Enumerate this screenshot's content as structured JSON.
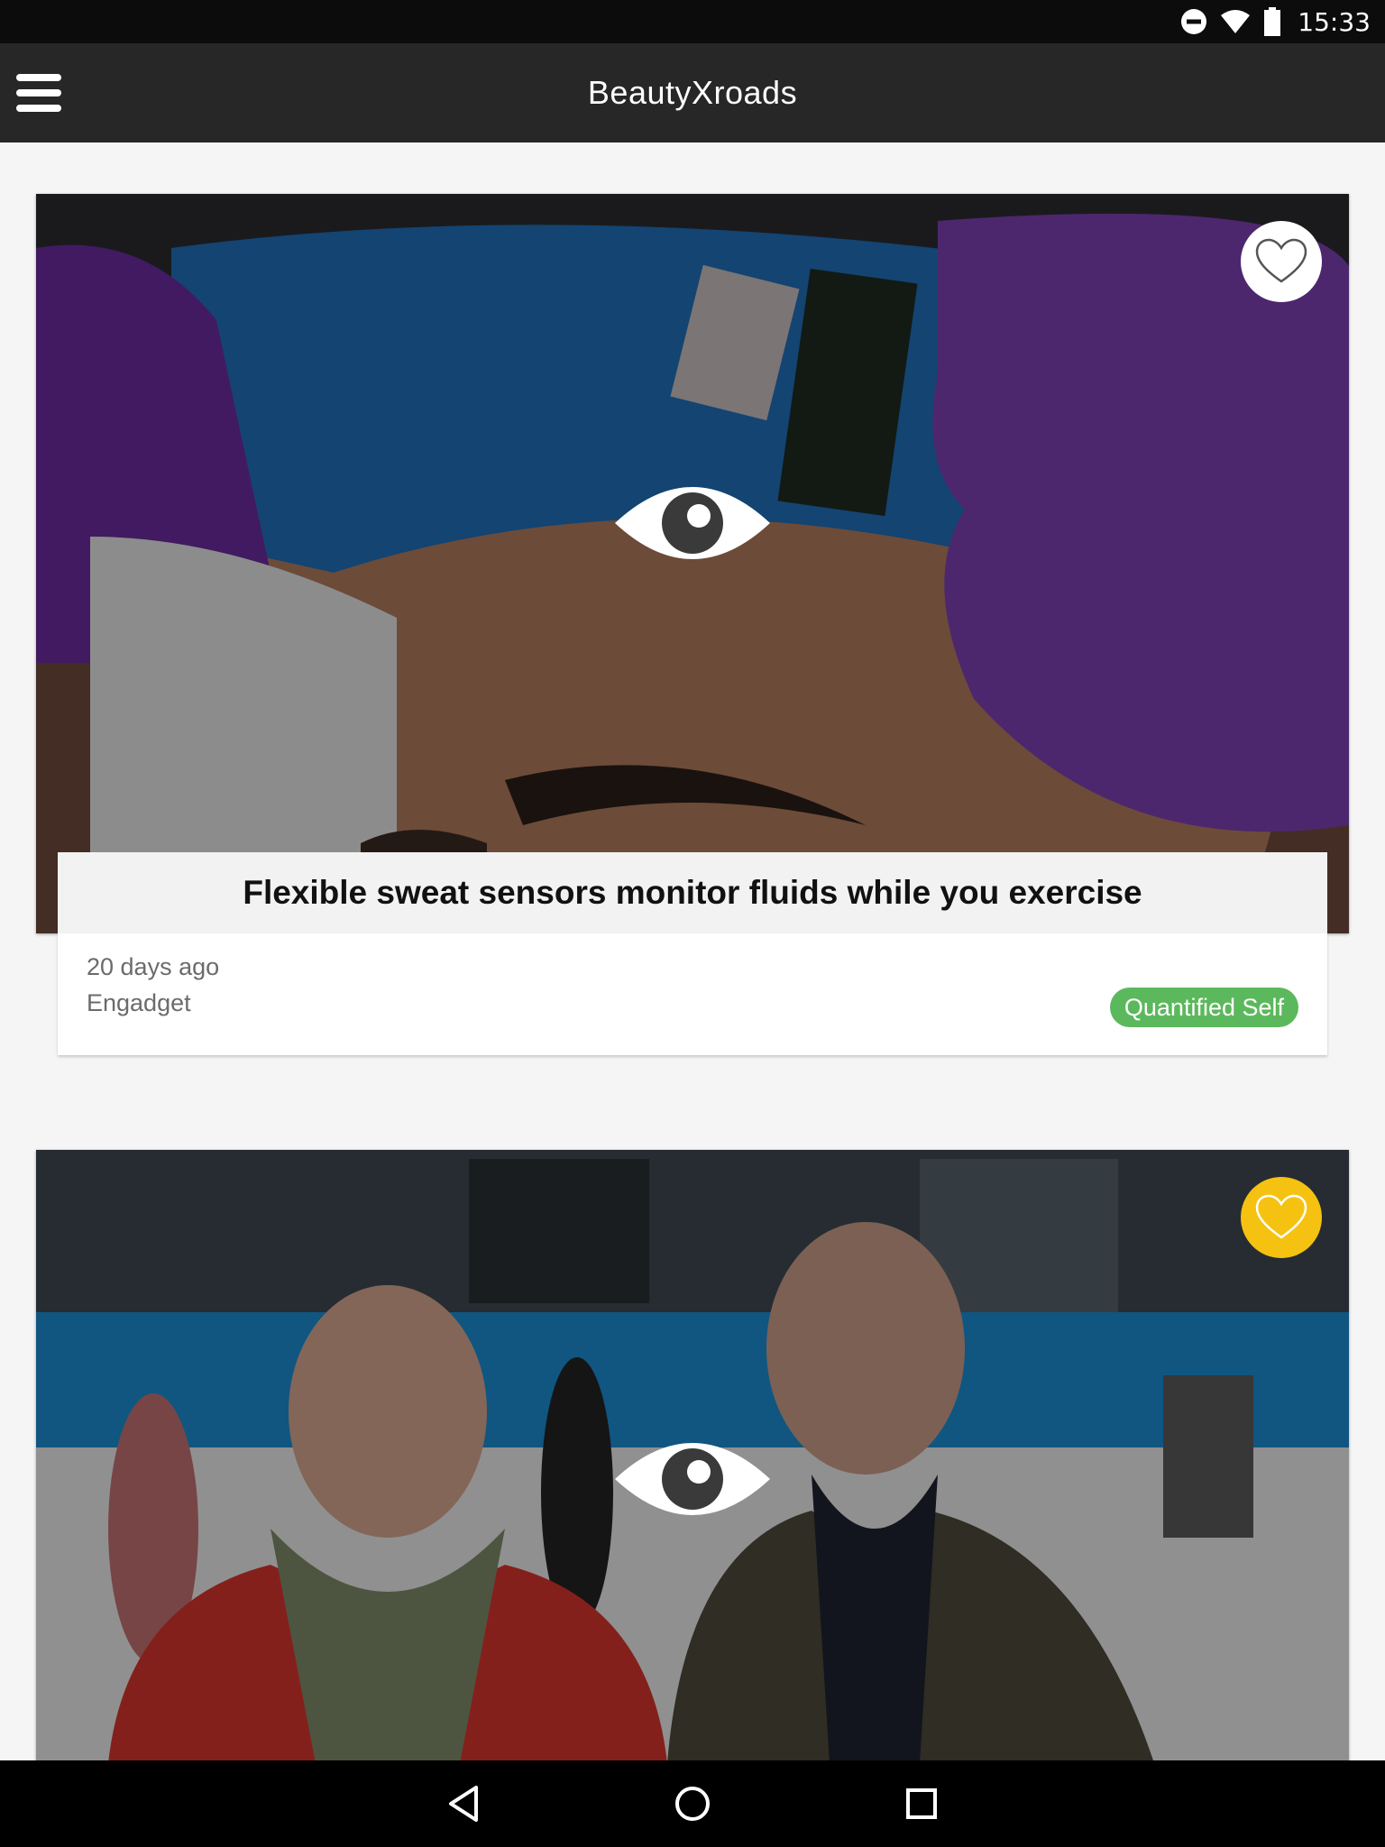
{
  "status_bar": {
    "time": "15:33",
    "icons": [
      "do-not-disturb-icon",
      "wifi-icon",
      "battery-icon"
    ]
  },
  "app_bar": {
    "title": "BeautyXroads",
    "menu_icon": "hamburger-menu-icon"
  },
  "articles": [
    {
      "title": "Flexible sweat sensors monitor fluids while you exercise",
      "age": "20 days ago",
      "source": "Engadget",
      "tag": "Quantified Self",
      "tag_color": "#5cb85c",
      "favorited": false
    },
    {
      "favorited": true,
      "favorite_color": "#f5c211"
    }
  ],
  "nav_bar": {
    "buttons": [
      "back-icon",
      "home-icon",
      "recents-icon"
    ]
  }
}
